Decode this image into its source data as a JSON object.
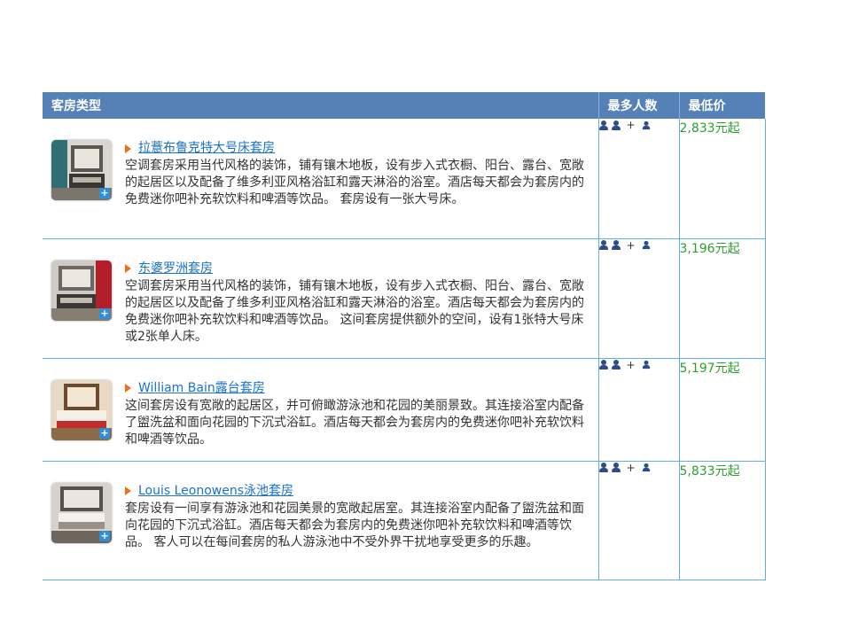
{
  "table": {
    "headers": {
      "room_type": "客房类型",
      "max_people": "最多人数",
      "lowest_price": "最低价"
    },
    "rooms": [
      {
        "title": "拉薏布鲁克特大号床套房",
        "description": "空调套房采用当代风格的装饰，铺有镶木地板，设有步入式衣橱、阳台、露台、宽敞的起居区以及配备了维多利亚风格浴缸和露天淋浴的浴室。酒店每天都会为套房内的免费迷你吧补充软饮料和啤酒等饮品。 套房设有一张大号床。",
        "capacity": "2 adults + 1 child",
        "price": "2,833元起"
      },
      {
        "title": "东婆罗洲套房",
        "description": "空调套房采用当代风格的装饰，铺有镶木地板，设有步入式衣橱、阳台、露台、宽敞的起居区以及配备了维多利亚风格浴缸和露天淋浴的浴室。酒店每天都会为套房内的免费迷你吧补充软饮料和啤酒等饮品。 这间套房提供额外的空间，设有1张特大号床或2张单人床。",
        "capacity": "2 adults + 1 child",
        "price": "3,196元起"
      },
      {
        "title": "William Bain露台套房",
        "description": "这间套房设有宽敞的起居区，并可俯瞰游泳池和花园的美丽景致。其连接浴室内配备了盥洗盆和面向花园的下沉式浴缸。酒店每天都会为套房内的免费迷你吧补充软饮料和啤酒等饮品。",
        "capacity": "2 adults + 1 child",
        "price": "5,197元起"
      },
      {
        "title": "Louis Leonowens泳池套房",
        "description": "套房设有一间享有游泳池和花园美景的宽敞起居室。其连接浴室内配备了盥洗盆和面向花园的下沉式浴缸。酒店每天都会为套房内的免费迷你吧补充软饮料和啤酒等饮品。 客人可以在每间套房的私人游泳池中不受外界干扰地享受更多的乐趣。",
        "capacity": "2 adults + 1 child",
        "price": "5,833元起"
      }
    ]
  },
  "icons": {
    "thumb_expand": "plus-icon",
    "title_bullet": "triangle-right-icon",
    "adult": "person-icon",
    "child": "person-small-icon"
  },
  "colors": {
    "header_bg": "#5681b7",
    "border": "#5fb0e0",
    "link": "#1a73c8",
    "price": "#2e9f2e",
    "bullet": "#ee6f16",
    "person": "#2c4d86"
  },
  "capacity_symbols": {
    "plus": "+"
  }
}
